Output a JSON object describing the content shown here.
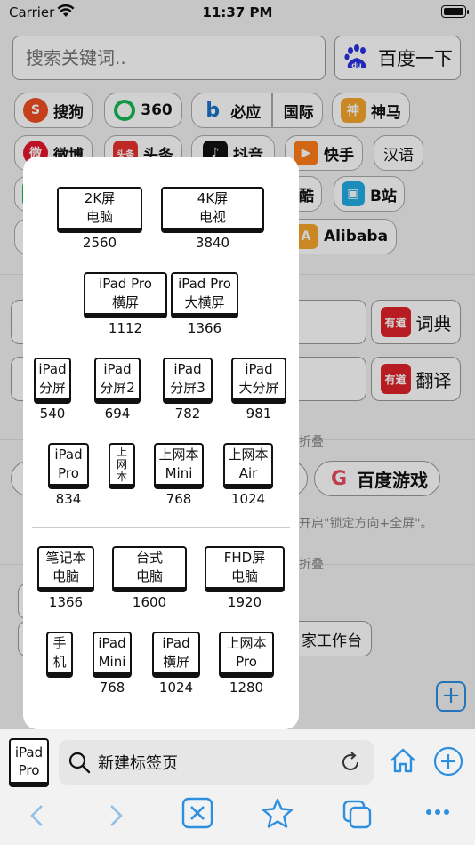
{
  "status": {
    "carrier": "Carrier",
    "time": "11:37 PM"
  },
  "search": {
    "placeholder": "搜索关键词..",
    "button": "百度一下"
  },
  "chips": {
    "sogou": "搜狗",
    "s360": "360",
    "bing": "必应",
    "intl": "国际",
    "shenma": "神马",
    "weibo": "微博",
    "toutiao": "头条",
    "douyin": "抖音",
    "kuaishou": "快手",
    "hanyu": "汉语",
    "ku": "酷",
    "bilibili": "B站",
    "alibaba": "Alibaba"
  },
  "dict": {
    "dict_btn": "词典",
    "trans_btn": "翻译",
    "youdao": "有道"
  },
  "faint": {
    "fold1": "折叠",
    "hint": "开启\"锁定方向+全屏\"。",
    "fold2": "折叠",
    "workbench": "家工作台"
  },
  "game": {
    "label": "百度游戏"
  },
  "devices": {
    "r1": [
      {
        "name": "2K屏\n电脑",
        "px": "2560"
      },
      {
        "name": "4K屏\n电视",
        "px": "3840"
      }
    ],
    "r2": [
      {
        "name": "iPad Pro\n横屏",
        "px": "1112"
      },
      {
        "name": "iPad Pro\n大横屏",
        "px": "1366"
      }
    ],
    "r3": [
      {
        "name": "iPad\n分屏",
        "px": "540"
      },
      {
        "name": "iPad\n分屏2",
        "px": "694"
      },
      {
        "name": "iPad\n分屏3",
        "px": "782"
      },
      {
        "name": "iPad\n大分屏",
        "px": "981"
      }
    ],
    "r4": [
      {
        "name": "iPad\nPro",
        "px": "834"
      },
      {
        "name": "上\n网\n本",
        "px": ""
      },
      {
        "name": "上网本\nMini",
        "px": "768"
      },
      {
        "name": "上网本\nAir",
        "px": "1024"
      }
    ],
    "r5": [
      {
        "name": "笔记本\n电脑",
        "px": "1366"
      },
      {
        "name": "台式\n电脑",
        "px": "1600"
      },
      {
        "name": "FHD屏\n电脑",
        "px": "1920"
      }
    ],
    "r6": [
      {
        "name": "手\n机",
        "px": ""
      },
      {
        "name": "iPad\nMini",
        "px": "768"
      },
      {
        "name": "iPad\n横屏",
        "px": "1024"
      },
      {
        "name": "上网本\nPro",
        "px": "1280"
      }
    ]
  },
  "tabbar": {
    "device_toggle": "iPad\nPro",
    "url_label": "新建标签页"
  },
  "colors": {
    "accent": "#2d8fe0"
  }
}
